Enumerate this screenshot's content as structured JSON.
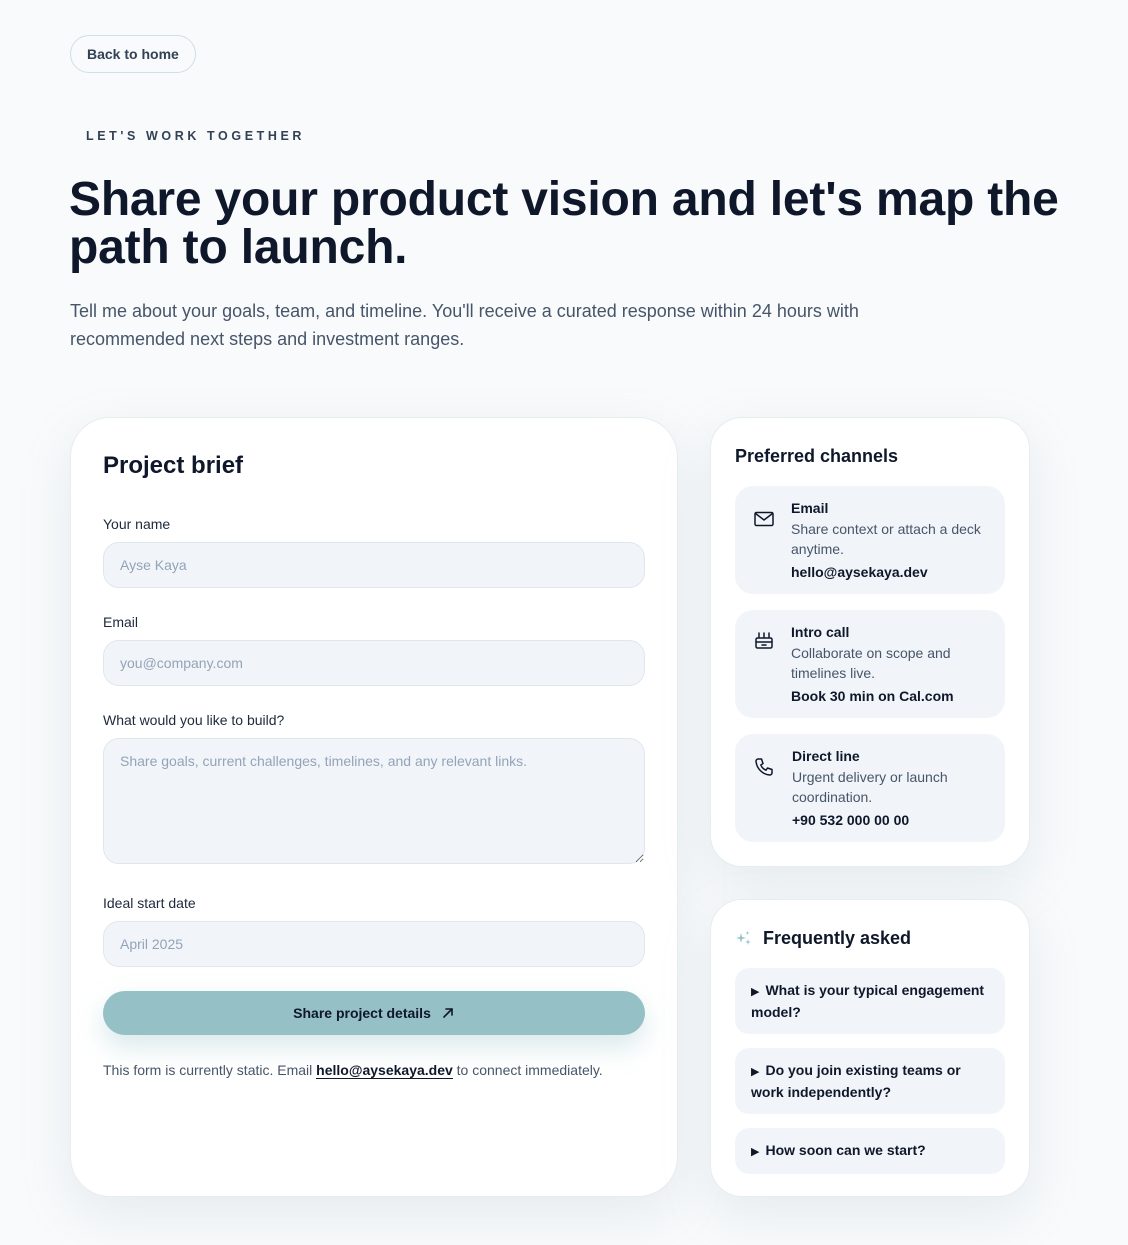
{
  "nav": {
    "back_label": "Back to home"
  },
  "hero": {
    "eyebrow": "LET'S WORK TOGETHER",
    "headline": "Share your product vision and let's map the path to launch.",
    "intro": "Tell me about your goals, team, and timeline. You'll receive a curated response within 24 hours with recommended next steps and investment ranges."
  },
  "brief": {
    "title": "Project brief",
    "fields": {
      "name": {
        "label": "Your name",
        "placeholder": "Ayse Kaya",
        "value": ""
      },
      "email": {
        "label": "Email",
        "placeholder": "you@company.com",
        "value": ""
      },
      "build": {
        "label": "What would you like to build?",
        "placeholder": "Share goals, current challenges, timelines, and any relevant links.",
        "value": ""
      },
      "start": {
        "label": "Ideal start date",
        "placeholder": "April 2025",
        "value": ""
      }
    },
    "submit_label": "Share project details",
    "submit_icon": "arrow-up-right-icon",
    "note_before": "This form is currently static. Email ",
    "note_link": "hello@aysekaya.dev",
    "note_after": " to connect immediately."
  },
  "channels": {
    "title": "Preferred channels",
    "items": [
      {
        "icon": "mail-icon",
        "title": "Email",
        "desc": "Share context or attach a deck anytime.",
        "value": "hello@aysekaya.dev"
      },
      {
        "icon": "calendar-icon",
        "title": "Intro call",
        "desc": "Collaborate on scope and timelines live.",
        "value": "Book 30 min on Cal.com"
      },
      {
        "icon": "phone-icon",
        "title": "Direct line",
        "desc": "Urgent delivery or launch coordination.",
        "value": "+90 532 000 00 00"
      }
    ]
  },
  "faq": {
    "title": "Frequently asked",
    "icon": "sparkles-icon",
    "items": [
      {
        "question": "What is your typical engagement model?"
      },
      {
        "question": "Do you join existing teams or work independently?"
      },
      {
        "question": "How soon can we start?"
      }
    ]
  },
  "colors": {
    "background": "#f8fafb",
    "accent": "#95c0c6",
    "text": "#0f172a",
    "muted": "#475569",
    "field_bg": "#f1f5f9"
  }
}
